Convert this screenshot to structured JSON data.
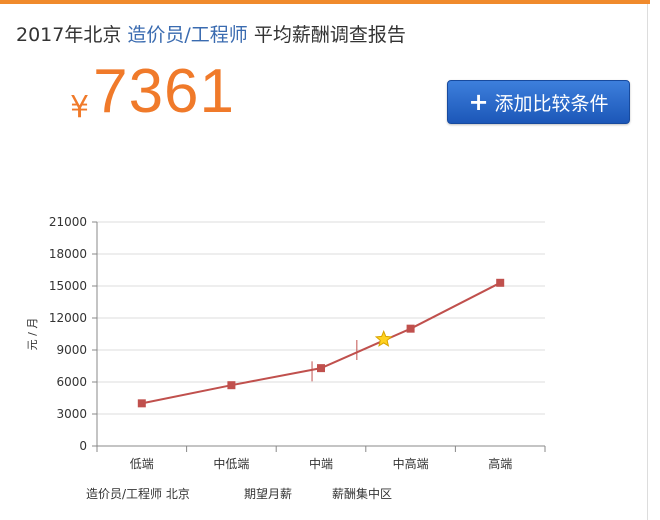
{
  "header": {
    "title_prefix": "2017年北京",
    "title_link": "造价员/工程师",
    "title_suffix": "平均薪酬调查报告"
  },
  "salary": {
    "currency": "¥",
    "value": "7361"
  },
  "compare_button": {
    "icon": "plus-icon",
    "label": "添加比较条件"
  },
  "colors": {
    "accent": "#f07a2a",
    "line": "#c0504d",
    "button": "#2a66c8",
    "link": "#3a6bb0"
  },
  "chart_data": {
    "type": "line",
    "ylabel": "元 / 月",
    "ylim": [
      0,
      21000
    ],
    "yticks": [
      0,
      3000,
      6000,
      9000,
      12000,
      15000,
      18000,
      21000
    ],
    "categories": [
      "低端",
      "中低端",
      "中端",
      "中高端",
      "高端"
    ],
    "series": [
      {
        "values": [
          4000,
          5700,
          7300,
          11000,
          15300
        ]
      }
    ],
    "markers": [
      {
        "type": "star",
        "x": 2.7,
        "y": 10000
      },
      {
        "type": "range-tick",
        "x": 1.9,
        "y": 7000
      },
      {
        "type": "range-tick",
        "x": 2.4,
        "y": 9000
      }
    ],
    "grid": true,
    "legend": [
      "造价员/工程师 北京",
      "期望月薪",
      "薪酬集中区"
    ],
    "legend_position": "bottom"
  }
}
